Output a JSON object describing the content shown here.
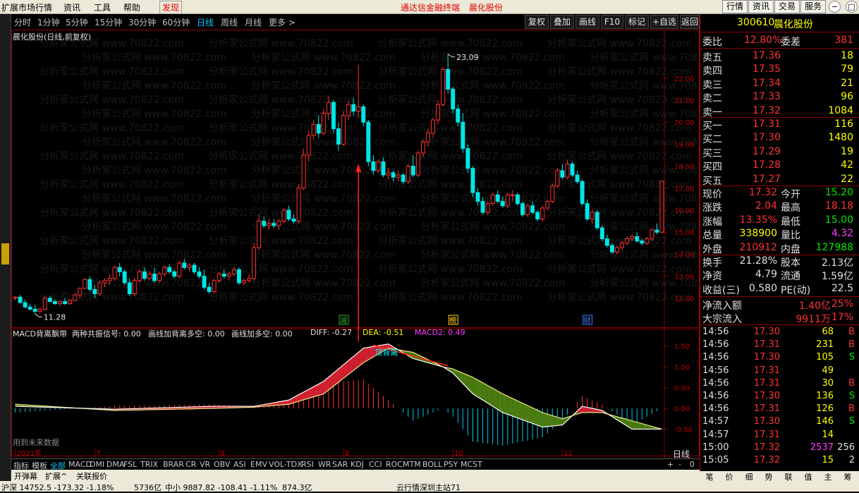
{
  "menu": {
    "items": [
      "扩展市场行情",
      "资讯",
      "工具",
      "帮助",
      "发现"
    ],
    "center": [
      "通达信金融终端",
      "晨化股份"
    ],
    "right_buttons": [
      "行情",
      "资讯",
      "交易",
      "服务"
    ],
    "window_buttons": [
      "−",
      "□",
      "×"
    ]
  },
  "toolbar": {
    "periods": [
      "分时",
      "1分钟",
      "5分钟",
      "15分钟",
      "30分钟",
      "60分钟",
      "日线",
      "周线",
      "月线",
      "更多 >"
    ],
    "active_period": "日线",
    "buttons": [
      "复权",
      "叠加",
      "画线",
      "F10",
      "标记",
      "+自选",
      "返回"
    ]
  },
  "main_chart": {
    "title": "晨化股份(日线,前复权)",
    "markers": {
      "high": "23.09",
      "low": "11.28"
    },
    "events": [
      "减",
      "榜",
      "财"
    ],
    "watermark": "分析家公式网 www.70822.com"
  },
  "chart_data": [
    {
      "type": "candlestick",
      "title": "晨化股份(日线,前复权)",
      "y_ticks": [
        "22.00",
        "21.00",
        "20.00",
        "19.00",
        "18.00",
        "17.00",
        "16.00",
        "15.00",
        "14.00",
        "13.00",
        "12.00"
      ],
      "ylim": [
        11.0,
        23.5
      ],
      "x_labels": [
        "2021年",
        "7",
        "8",
        "9",
        "10",
        "11"
      ],
      "high": 23.09,
      "low": 11.28,
      "candles": [
        [
          12.0,
          12.1,
          11.9,
          12.05
        ],
        [
          12.05,
          12.15,
          11.75,
          11.8
        ],
        [
          11.8,
          11.95,
          11.55,
          11.6
        ],
        [
          11.6,
          11.75,
          11.45,
          11.5
        ],
        [
          11.5,
          11.7,
          11.28,
          11.4
        ],
        [
          11.4,
          11.55,
          11.3,
          11.5
        ],
        [
          11.5,
          12.1,
          11.45,
          12.0
        ],
        [
          12.0,
          12.1,
          11.8,
          11.85
        ],
        [
          11.85,
          11.95,
          11.7,
          11.75
        ],
        [
          11.75,
          11.9,
          11.65,
          11.85
        ],
        [
          11.85,
          12.0,
          11.7,
          11.75
        ],
        [
          11.75,
          11.95,
          11.7,
          11.9
        ],
        [
          11.9,
          12.2,
          11.85,
          12.15
        ],
        [
          12.15,
          12.5,
          12.0,
          12.45
        ],
        [
          12.45,
          12.9,
          12.4,
          12.85
        ],
        [
          12.85,
          13.0,
          12.3,
          12.4
        ],
        [
          12.4,
          12.6,
          12.0,
          12.2
        ],
        [
          12.2,
          12.8,
          12.1,
          12.7
        ],
        [
          12.7,
          12.9,
          12.5,
          12.8
        ],
        [
          12.8,
          13.1,
          12.6,
          12.9
        ],
        [
          12.9,
          13.5,
          12.8,
          13.4
        ],
        [
          13.4,
          13.6,
          13.0,
          13.2
        ],
        [
          13.2,
          13.3,
          12.6,
          12.7
        ],
        [
          12.7,
          12.9,
          12.1,
          12.2
        ],
        [
          12.2,
          12.9,
          12.1,
          12.8
        ],
        [
          12.8,
          13.3,
          12.7,
          13.2
        ],
        [
          13.2,
          13.4,
          12.8,
          12.9
        ],
        [
          12.9,
          13.2,
          12.8,
          13.1
        ],
        [
          13.1,
          13.4,
          12.7,
          12.8
        ],
        [
          12.8,
          13.2,
          12.7,
          13.1
        ],
        [
          13.1,
          13.5,
          13.0,
          13.4
        ],
        [
          13.4,
          13.55,
          13.1,
          13.2
        ],
        [
          13.2,
          13.3,
          12.9,
          13.0
        ],
        [
          13.0,
          13.7,
          12.9,
          13.6
        ],
        [
          13.6,
          13.8,
          13.3,
          13.4
        ],
        [
          13.4,
          13.6,
          13.2,
          13.5
        ],
        [
          13.5,
          13.6,
          13.1,
          13.2
        ],
        [
          13.2,
          13.4,
          12.9,
          13.0
        ],
        [
          13.0,
          13.3,
          12.4,
          12.5
        ],
        [
          12.5,
          12.7,
          12.2,
          12.3
        ],
        [
          12.3,
          12.9,
          12.2,
          12.8
        ],
        [
          12.8,
          13.2,
          12.7,
          13.1
        ],
        [
          13.1,
          13.3,
          12.9,
          13.0
        ],
        [
          13.0,
          13.2,
          12.8,
          13.1
        ],
        [
          13.1,
          13.4,
          13.0,
          13.3
        ],
        [
          13.3,
          13.4,
          12.6,
          12.7
        ],
        [
          12.7,
          12.9,
          12.6,
          12.8
        ],
        [
          12.8,
          13.1,
          12.7,
          12.9
        ],
        [
          12.9,
          14.5,
          12.8,
          14.3
        ],
        [
          14.3,
          15.8,
          14.2,
          15.5
        ],
        [
          15.5,
          15.7,
          15.2,
          15.3
        ],
        [
          15.3,
          15.6,
          15.1,
          15.4
        ],
        [
          15.4,
          15.6,
          15.2,
          15.3
        ],
        [
          15.3,
          15.6,
          15.1,
          15.5
        ],
        [
          15.5,
          16.1,
          15.4,
          16.0
        ],
        [
          16.0,
          16.2,
          15.5,
          15.6
        ],
        [
          15.6,
          15.8,
          15.4,
          15.5
        ],
        [
          15.5,
          17.2,
          15.4,
          17.0
        ],
        [
          17.0,
          18.8,
          16.9,
          18.5
        ],
        [
          18.5,
          19.6,
          18.2,
          19.4
        ],
        [
          19.4,
          20.1,
          19.2,
          19.9
        ],
        [
          19.9,
          20.3,
          19.3,
          19.5
        ],
        [
          19.5,
          20.6,
          19.4,
          20.4
        ],
        [
          20.4,
          21.2,
          20.1,
          20.9
        ],
        [
          20.9,
          21.0,
          19.5,
          19.7
        ],
        [
          19.7,
          20.0,
          18.7,
          19.0
        ],
        [
          19.0,
          20.5,
          18.9,
          20.3
        ],
        [
          20.3,
          21.0,
          20.1,
          20.8
        ],
        [
          20.8,
          21.1,
          20.3,
          20.5
        ],
        [
          20.5,
          22.6,
          20.2,
          20.7
        ],
        [
          20.7,
          20.8,
          19.8,
          20.0
        ],
        [
          20.0,
          20.1,
          18.0,
          18.2
        ],
        [
          18.2,
          18.5,
          17.6,
          17.8
        ],
        [
          17.8,
          18.3,
          17.7,
          18.2
        ],
        [
          18.2,
          18.4,
          17.5,
          17.6
        ],
        [
          17.6,
          17.9,
          17.4,
          17.7
        ],
        [
          17.7,
          17.8,
          17.3,
          17.5
        ],
        [
          17.5,
          17.8,
          17.3,
          17.6
        ],
        [
          17.6,
          17.7,
          17.2,
          17.3
        ],
        [
          17.3,
          18.1,
          17.2,
          18.0
        ],
        [
          18.0,
          18.5,
          17.5,
          17.6
        ],
        [
          17.6,
          18.7,
          17.5,
          18.6
        ],
        [
          18.6,
          19.2,
          18.4,
          19.1
        ],
        [
          19.1,
          19.7,
          18.9,
          19.5
        ],
        [
          19.5,
          20.2,
          19.3,
          20.1
        ],
        [
          20.1,
          21.0,
          19.9,
          20.8
        ],
        [
          20.8,
          22.5,
          20.7,
          22.4
        ],
        [
          22.4,
          23.09,
          21.3,
          21.5
        ],
        [
          21.5,
          21.6,
          20.4,
          20.6
        ],
        [
          20.6,
          20.8,
          19.8,
          20.0
        ],
        [
          20.0,
          20.4,
          18.6,
          18.8
        ],
        [
          18.8,
          19.0,
          17.7,
          17.9
        ],
        [
          17.9,
          18.0,
          16.6,
          16.8
        ],
        [
          16.8,
          17.0,
          16.2,
          16.4
        ],
        [
          16.4,
          16.6,
          15.8,
          15.9
        ],
        [
          15.9,
          16.4,
          15.8,
          16.3
        ],
        [
          16.3,
          16.8,
          16.2,
          16.7
        ],
        [
          16.7,
          16.9,
          16.3,
          16.4
        ],
        [
          16.4,
          16.6,
          16.1,
          16.2
        ],
        [
          16.2,
          16.8,
          16.1,
          16.7
        ],
        [
          16.7,
          16.9,
          16.4,
          16.7
        ],
        [
          16.7,
          16.8,
          16.2,
          16.3
        ],
        [
          16.3,
          16.4,
          15.7,
          15.8
        ],
        [
          15.8,
          16.3,
          15.7,
          16.2
        ],
        [
          16.2,
          16.4,
          15.8,
          15.9
        ],
        [
          15.9,
          16.0,
          15.5,
          15.6
        ],
        [
          15.6,
          16.2,
          15.5,
          16.1
        ],
        [
          16.1,
          16.5,
          16.0,
          16.4
        ],
        [
          16.4,
          17.2,
          16.3,
          17.1
        ],
        [
          17.1,
          17.9,
          17.0,
          17.8
        ],
        [
          17.8,
          18.1,
          17.4,
          17.5
        ],
        [
          17.5,
          18.3,
          17.4,
          18.1
        ],
        [
          18.1,
          18.2,
          17.5,
          17.6
        ],
        [
          17.6,
          17.8,
          17.2,
          17.3
        ],
        [
          17.3,
          17.4,
          16.2,
          16.3
        ],
        [
          16.3,
          16.5,
          15.5,
          15.6
        ],
        [
          15.6,
          16.0,
          15.4,
          15.9
        ],
        [
          15.9,
          16.0,
          15.1,
          15.2
        ],
        [
          15.2,
          15.3,
          14.6,
          14.7
        ],
        [
          14.7,
          14.9,
          14.3,
          14.4
        ],
        [
          14.4,
          14.5,
          14.0,
          14.1
        ],
        [
          14.1,
          14.4,
          14.0,
          14.3
        ],
        [
          14.3,
          14.6,
          14.2,
          14.5
        ],
        [
          14.5,
          14.8,
          14.4,
          14.7
        ],
        [
          14.7,
          14.9,
          14.6,
          14.8
        ],
        [
          14.8,
          15.0,
          14.5,
          14.6
        ],
        [
          14.6,
          14.7,
          14.4,
          14.5
        ],
        [
          14.5,
          14.8,
          14.4,
          14.7
        ],
        [
          14.7,
          15.2,
          14.6,
          15.1
        ],
        [
          15.1,
          15.4,
          14.9,
          15.0
        ],
        [
          15.0,
          17.32,
          14.95,
          17.32
        ]
      ]
    },
    {
      "type": "macd",
      "title": "MACD背离飘带",
      "legend": [
        "两种共振信号: 0.00",
        "画线加背离多空: 0.00",
        "画线加多空: 0.00"
      ],
      "values_text": {
        "diff": "DIFF: -0.27",
        "dea": "DEA: -0.51",
        "macd2": "MACD2: 0.49"
      },
      "y_ticks": [
        "1.50",
        "1.00",
        "0.50",
        "0.00",
        "-0.50"
      ],
      "ylim": [
        -0.9,
        1.75
      ],
      "annotation": "顶背离",
      "diff_keys": [
        [
          0,
          0.05
        ],
        [
          20,
          -0.02
        ],
        [
          40,
          0.05
        ],
        [
          48,
          0.05
        ],
        [
          55,
          0.2
        ],
        [
          62,
          0.65
        ],
        [
          70,
          1.45
        ],
        [
          75,
          1.55
        ],
        [
          80,
          1.2
        ],
        [
          86,
          1.0
        ],
        [
          88,
          0.85
        ],
        [
          92,
          0.35
        ],
        [
          98,
          -0.1
        ],
        [
          106,
          -0.45
        ],
        [
          110,
          -0.4
        ],
        [
          114,
          0.05
        ],
        [
          118,
          -0.05
        ],
        [
          124,
          -0.5
        ],
        [
          130,
          -0.5
        ],
        [
          134,
          -0.27
        ]
      ],
      "dea_keys": [
        [
          0,
          0.1
        ],
        [
          20,
          -0.05
        ],
        [
          40,
          0.0
        ],
        [
          48,
          0.03
        ],
        [
          55,
          0.1
        ],
        [
          62,
          0.35
        ],
        [
          70,
          1.1
        ],
        [
          75,
          1.45
        ],
        [
          80,
          1.35
        ],
        [
          86,
          1.0
        ],
        [
          88,
          0.95
        ],
        [
          92,
          0.75
        ],
        [
          98,
          0.35
        ],
        [
          106,
          -0.1
        ],
        [
          110,
          -0.25
        ],
        [
          114,
          -0.1
        ],
        [
          118,
          -0.1
        ],
        [
          124,
          -0.3
        ],
        [
          130,
          -0.5
        ],
        [
          134,
          -0.51
        ]
      ]
    }
  ],
  "quote": {
    "code": "300610",
    "name": "晨化股份",
    "wb_label": "委比",
    "wb_value": "12.80%",
    "wc_label": "委差",
    "wc_value": "381",
    "asks": [
      {
        "label": "卖五",
        "price": "17.36",
        "vol": "18"
      },
      {
        "label": "卖四",
        "price": "17.35",
        "vol": "79"
      },
      {
        "label": "卖三",
        "price": "17.34",
        "vol": "21"
      },
      {
        "label": "卖二",
        "price": "17.33",
        "vol": "96"
      },
      {
        "label": "卖一",
        "price": "17.32",
        "vol": "1084"
      }
    ],
    "bids": [
      {
        "label": "买一",
        "price": "17.31",
        "vol": "116"
      },
      {
        "label": "买二",
        "price": "17.30",
        "vol": "1480"
      },
      {
        "label": "买三",
        "price": "17.29",
        "vol": "19"
      },
      {
        "label": "买四",
        "price": "17.28",
        "vol": "42"
      },
      {
        "label": "买五",
        "price": "17.27",
        "vol": "22"
      }
    ],
    "stats": [
      {
        "l1": "现价",
        "v1": "17.32",
        "l2": "今开",
        "v2": "15.20"
      },
      {
        "l1": "涨跌",
        "v1": "2.04",
        "l2": "最高",
        "v2": "18.18"
      },
      {
        "l1": "涨幅",
        "v1": "13.35%",
        "l2": "最低",
        "v2": "15.00"
      },
      {
        "l1": "总量",
        "v1": "338900",
        "l2": "量比",
        "v2": "4.32"
      },
      {
        "l1": "外盘",
        "v1": "210912",
        "l2": "内盘",
        "v2": "127988"
      }
    ],
    "stats2": [
      {
        "l1": "换手",
        "v1": "21.28%",
        "l2": "股本",
        "v2": "2.13亿"
      },
      {
        "l1": "净资",
        "v1": "4.79",
        "l2": "流通",
        "v2": "1.59亿"
      },
      {
        "l1": "收益(三)",
        "v1": "0.580",
        "l2": "PE(动)",
        "v2": "22.5"
      }
    ],
    "flows": [
      {
        "label": "净流入额",
        "value": "1.40亿",
        "pct": "25%"
      },
      {
        "label": "大宗流入",
        "value": "9911万",
        "pct": "17%"
      }
    ]
  },
  "ticks": [
    {
      "time": "14:56",
      "price": "17.30",
      "vol": "68",
      "side": "B"
    },
    {
      "time": "14:56",
      "price": "17.31",
      "vol": "231",
      "side": "B"
    },
    {
      "time": "14:56",
      "price": "17.30",
      "vol": "105",
      "side": "S"
    },
    {
      "time": "14:56",
      "price": "17.31",
      "vol": "49",
      "side": ""
    },
    {
      "time": "14:56",
      "price": "17.31",
      "vol": "30",
      "side": "B"
    },
    {
      "time": "14:56",
      "price": "17.30",
      "vol": "136",
      "side": "S"
    },
    {
      "time": "14:56",
      "price": "17.31",
      "vol": "126",
      "side": "B"
    },
    {
      "time": "14:57",
      "price": "17.30",
      "vol": "146",
      "side": "S"
    },
    {
      "time": "14:57",
      "price": "17.31",
      "vol": "14",
      "side": ""
    },
    {
      "time": "15:00",
      "price": "17.32",
      "vol": "2537",
      "side": "256"
    },
    {
      "time": "15:05",
      "price": "17.32",
      "vol": "15",
      "side": "2"
    }
  ],
  "right_tabs": [
    "笔",
    "价",
    "细",
    "势",
    "联",
    "值",
    "主",
    "筹"
  ],
  "indicators": [
    "指标",
    "模板",
    "全部",
    "MACD",
    "DMI",
    "DMA",
    "FSL",
    "TRIX",
    "BRAR",
    "CR",
    "VR",
    "OBV",
    "ASI",
    "EMV",
    "VOL-TDX",
    "RSI",
    "WR",
    "SAR",
    "KDJ",
    "CCI",
    "ROC",
    "MTM",
    "BOLL",
    "PSY",
    "MCST"
  ],
  "indicator_right": [
    "+",
    "-",
    "0"
  ],
  "bottom_tabs": [
    "开弹幕",
    "扩展^",
    "关联报价"
  ],
  "period_label": "日线",
  "future_label": "用到未来数据",
  "status_bar": {
    "sh": "沪深 14752.5 -173.32 -1.18%",
    "amt1": "5736亿",
    "mid": "中小 9887.82 -108.41 -1.11%",
    "amt2": "874.3亿",
    "ticker": "云行情深圳主站71"
  }
}
